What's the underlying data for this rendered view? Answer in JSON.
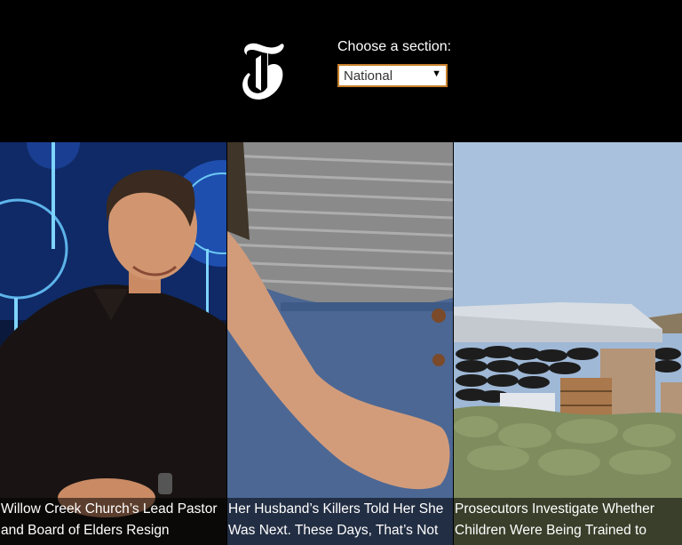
{
  "header": {
    "logo_icon": "nyt-t-logo-icon",
    "section_label": "Choose a section:",
    "section_select": {
      "selected": "National",
      "arrow": "▼"
    },
    "accent_color": "#c7802b"
  },
  "stories": [
    {
      "headline": "Willow Creek Church’s Lead Pastor and Board of Elders Resign"
    },
    {
      "headline": "Her Husband’s Killers Told Her She Was Next. These Days, That’s Not"
    },
    {
      "headline": "Prosecutors Investigate Whether Children Were Being Trained to"
    }
  ]
}
